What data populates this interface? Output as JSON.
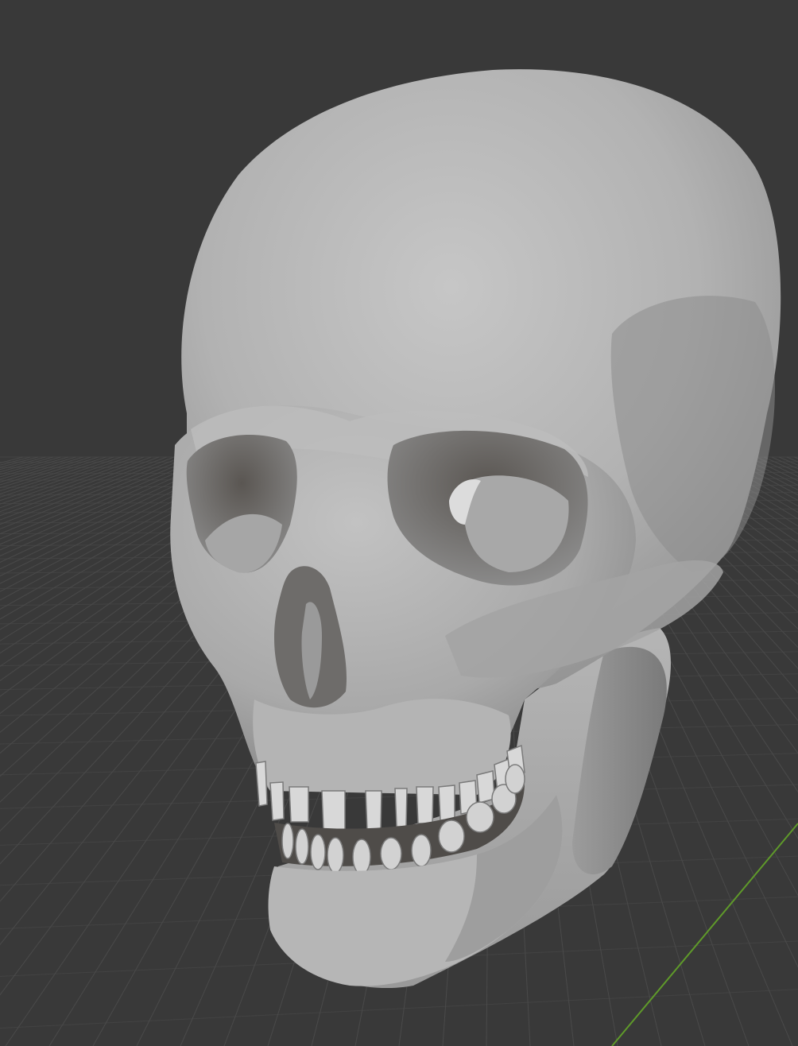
{
  "viewport": {
    "mode": "3d-viewport",
    "shading": "solid",
    "object": "skull-mesh",
    "show_floor_grid": true,
    "show_axis_y": true
  },
  "colors": {
    "background": "#393939",
    "grid_line": "#4a4a4a",
    "grid_line_minor": "#434343",
    "axis_y": "#5f9a2a",
    "mesh_light": "#c4c4c4",
    "mesh_mid": "#a8a8a8",
    "mesh_dark": "#707070",
    "cavity": "#4e4b48"
  }
}
